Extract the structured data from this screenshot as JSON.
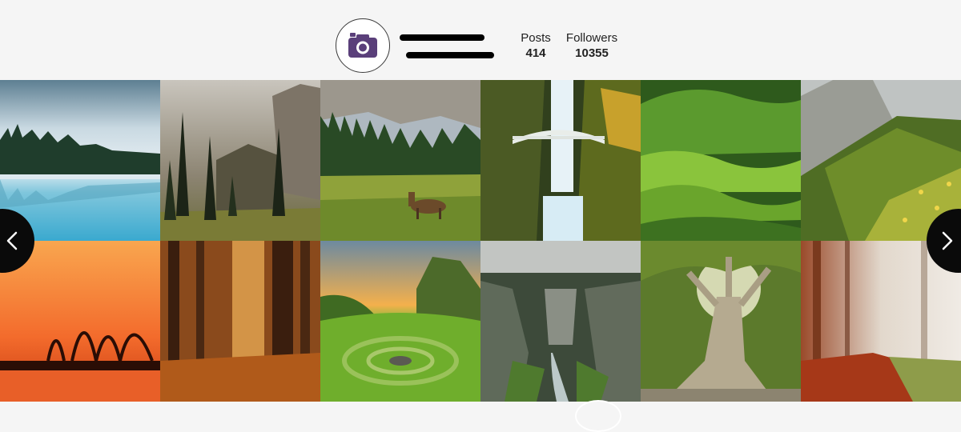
{
  "profile": {
    "username": "••••••••••••••",
    "handle": "@••••••••••••••••",
    "avatar_icon": "camera-icon",
    "avatar_color": "#5a3f7a"
  },
  "stats": {
    "posts_label": "Posts",
    "posts_value": "414",
    "followers_label": "Followers",
    "followers_value": "10355"
  },
  "gallery": {
    "tiles": [
      {
        "name": "misty-lake-forest"
      },
      {
        "name": "forest-cliff-sunset"
      },
      {
        "name": "deer-in-meadow"
      },
      {
        "name": "waterfall-bridge"
      },
      {
        "name": "green-rolling-hills"
      },
      {
        "name": "alpine-slope-flowers"
      },
      {
        "name": "orange-sunset-lake"
      },
      {
        "name": "autumn-forest-sunlight"
      },
      {
        "name": "green-valley-stone-circle"
      },
      {
        "name": "rocky-canyon-river"
      },
      {
        "name": "giant-tree-sunburst"
      },
      {
        "name": "autumn-misty-path"
      }
    ]
  },
  "navigation": {
    "prev_icon": "chevron-left-icon",
    "next_icon": "chevron-right-icon"
  }
}
